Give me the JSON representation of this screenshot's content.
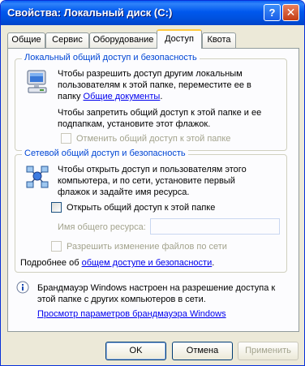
{
  "window": {
    "title": "Свойства: Локальный диск (C:)",
    "help_label": "?",
    "close_label": "✕"
  },
  "tabs": [
    {
      "label": "Общие",
      "active": false
    },
    {
      "label": "Сервис",
      "active": false
    },
    {
      "label": "Оборудование",
      "active": false
    },
    {
      "label": "Доступ",
      "active": true
    },
    {
      "label": "Квота",
      "active": false
    }
  ],
  "local_sharing": {
    "legend": "Локальный общий доступ и безопасность",
    "line1": "Чтобы разрешить доступ другим локальным",
    "line2": "пользователям к этой папке, переместите ее в",
    "line3_prefix": "папку ",
    "line3_link": "Общие документы",
    "line3_suffix": ".",
    "line4": "Чтобы запретить общий доступ к этой папке и ее",
    "line5": "подпапкам, установите этот флажок.",
    "checkbox_label": "Отменить общий доступ к этой папке",
    "checkbox_checked": false,
    "icon": "computer-icon"
  },
  "network_sharing": {
    "legend": "Сетевой общий доступ и безопасность",
    "line1": "Чтобы открыть доступ и пользователям этого",
    "line2": "компьютера, и по сети, установите первый",
    "line3": "флажок и задайте имя ресурса.",
    "share_checkbox_label": "Открыть общий доступ к этой папке",
    "share_checked": false,
    "share_name_label": "Имя общего ресурса:",
    "share_name_value": "",
    "allow_changes_label": "Разрешить изменение файлов по сети",
    "allow_changes_checked": false,
    "more_prefix": "Подробнее об ",
    "more_link": "общем доступе и безопасности",
    "more_suffix": ".",
    "icon": "network-icon"
  },
  "firewall": {
    "line1": "Брандмауэр Windows настроен на разрешение доступа к",
    "line2": "этой папке с других компьютеров в сети.",
    "link": "Просмотр параметров брандмауэра Windows",
    "icon": "info-icon"
  },
  "buttons": {
    "ok": "OK",
    "cancel": "Отмена",
    "apply": "Применить"
  }
}
